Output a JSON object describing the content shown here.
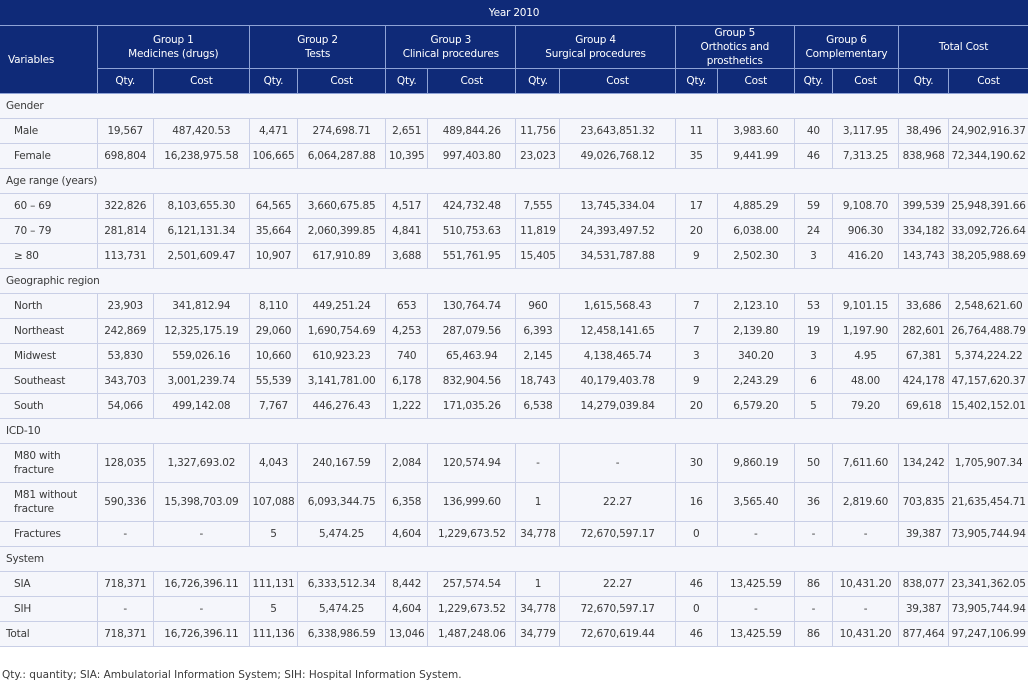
{
  "table": {
    "year_header": "Year 2010",
    "variables_header": "Variables",
    "groups": [
      {
        "line1": "Group 1",
        "line2": "Medicines (drugs)"
      },
      {
        "line1": "Group 2",
        "line2": "Tests"
      },
      {
        "line1": "Group 3",
        "line2": "Clinical procedures"
      },
      {
        "line1": "Group 4",
        "line2": "Surgical procedures"
      },
      {
        "line1": "Group 5",
        "line2": "Orthotics and prosthetics"
      },
      {
        "line1": "Group 6",
        "line2": "Complementary"
      },
      {
        "line1": "Total Cost",
        "line2": ""
      }
    ],
    "sub_headers": {
      "qty": "Qty.",
      "cost": "Cost"
    },
    "sections": [
      {
        "title": "Gender",
        "rows": [
          {
            "label": "Male",
            "values": [
              "19,567",
              "487,420.53",
              "4,471",
              "274,698.71",
              "2,651",
              "489,844.26",
              "11,756",
              "23,643,851.32",
              "11",
              "3,983.60",
              "40",
              "3,117.95",
              "38,496",
              "24,902,916.37"
            ]
          },
          {
            "label": "Female",
            "values": [
              "698,804",
              "16,238,975.58",
              "106,665",
              "6,064,287.88",
              "10,395",
              "997,403.80",
              "23,023",
              "49,026,768.12",
              "35",
              "9,441.99",
              "46",
              "7,313.25",
              "838,968",
              "72,344,190.62"
            ]
          }
        ]
      },
      {
        "title": "Age range (years)",
        "rows": [
          {
            "label": "60 – 69",
            "values": [
              "322,826",
              "8,103,655.30",
              "64,565",
              "3,660,675.85",
              "4,517",
              "424,732.48",
              "7,555",
              "13,745,334.04",
              "17",
              "4,885.29",
              "59",
              "9,108.70",
              "399,539",
              "25,948,391.66"
            ]
          },
          {
            "label": "70 – 79",
            "values": [
              "281,814",
              "6,121,131.34",
              "35,664",
              "2,060,399.85",
              "4,841",
              "510,753.63",
              "11,819",
              "24,393,497.52",
              "20",
              "6,038.00",
              "24",
              "906.30",
              "334,182",
              "33,092,726.64"
            ]
          },
          {
            "label": "≥ 80",
            "values": [
              "113,731",
              "2,501,609.47",
              "10,907",
              "617,910.89",
              "3,688",
              "551,761.95",
              "15,405",
              "34,531,787.88",
              "9",
              "2,502.30",
              "3",
              "416.20",
              "143,743",
              "38,205,988.69"
            ]
          }
        ]
      },
      {
        "title": "Geographic region",
        "rows": [
          {
            "label": "North",
            "values": [
              "23,903",
              "341,812.94",
              "8,110",
              "449,251.24",
              "653",
              "130,764.74",
              "960",
              "1,615,568.43",
              "7",
              "2,123.10",
              "53",
              "9,101.15",
              "33,686",
              "2,548,621.60"
            ]
          },
          {
            "label": "Northeast",
            "values": [
              "242,869",
              "12,325,175.19",
              "29,060",
              "1,690,754.69",
              "4,253",
              "287,079.56",
              "6,393",
              "12,458,141.65",
              "7",
              "2,139.80",
              "19",
              "1,197.90",
              "282,601",
              "26,764,488.79"
            ]
          },
          {
            "label": "Midwest",
            "values": [
              "53,830",
              "559,026.16",
              "10,660",
              "610,923.23",
              "740",
              "65,463.94",
              "2,145",
              "4,138,465.74",
              "3",
              "340.20",
              "3",
              "4.95",
              "67,381",
              "5,374,224.22"
            ]
          },
          {
            "label": "Southeast",
            "values": [
              "343,703",
              "3,001,239.74",
              "55,539",
              "3,141,781.00",
              "6,178",
              "832,904.56",
              "18,743",
              "40,179,403.78",
              "9",
              "2,243.29",
              "6",
              "48.00",
              "424,178",
              "47,157,620.37"
            ]
          },
          {
            "label": "South",
            "values": [
              "54,066",
              "499,142.08",
              "7,767",
              "446,276.43",
              "1,222",
              "171,035.26",
              "6,538",
              "14,279,039.84",
              "20",
              "6,579.20",
              "5",
              "79.20",
              "69,618",
              "15,402,152.01"
            ]
          }
        ]
      },
      {
        "title": "ICD-10",
        "rows": [
          {
            "label": "M80 with fracture",
            "tall": true,
            "values": [
              "128,035",
              "1,327,693.02",
              "4,043",
              "240,167.59",
              "2,084",
              "120,574.94",
              "-",
              "-",
              "30",
              "9,860.19",
              "50",
              "7,611.60",
              "134,242",
              "1,705,907.34"
            ]
          },
          {
            "label": "M81 without fracture",
            "tall": true,
            "values": [
              "590,336",
              "15,398,703.09",
              "107,088",
              "6,093,344.75",
              "6,358",
              "136,999.60",
              "1",
              "22.27",
              "16",
              "3,565.40",
              "36",
              "2,819.60",
              "703,835",
              "21,635,454.71"
            ]
          },
          {
            "label": "Fractures",
            "values": [
              "-",
              "-",
              "5",
              "5,474.25",
              "4,604",
              "1,229,673.52",
              "34,778",
              "72,670,597.17",
              "0",
              "-",
              "-",
              "-",
              "39,387",
              "73,905,744.94"
            ]
          }
        ]
      },
      {
        "title": "System",
        "rows": [
          {
            "label": "SIA",
            "values": [
              "718,371",
              "16,726,396.11",
              "111,131",
              "6,333,512.34",
              "8,442",
              "257,574.54",
              "1",
              "22.27",
              "46",
              "13,425.59",
              "86",
              "10,431.20",
              "838,077",
              "23,341,362.05"
            ]
          },
          {
            "label": "SIH",
            "values": [
              "-",
              "-",
              "5",
              "5,474.25",
              "4,604",
              "1,229,673.52",
              "34,778",
              "72,670,597.17",
              "0",
              "-",
              "-",
              "-",
              "39,387",
              "73,905,744.94"
            ]
          }
        ]
      }
    ],
    "total_row": {
      "label": "Total",
      "values": [
        "718,371",
        "16,726,396.11",
        "111,136",
        "6,338,986.59",
        "13,046",
        "1,487,248.06",
        "34,779",
        "72,670,619.44",
        "46",
        "13,425.59",
        "86",
        "10,431.20",
        "877,464",
        "97,247,106.99"
      ]
    }
  },
  "footnote": "Qty.: quantity; SIA: Ambulatorial Information System; SIH: Hospital Information System."
}
